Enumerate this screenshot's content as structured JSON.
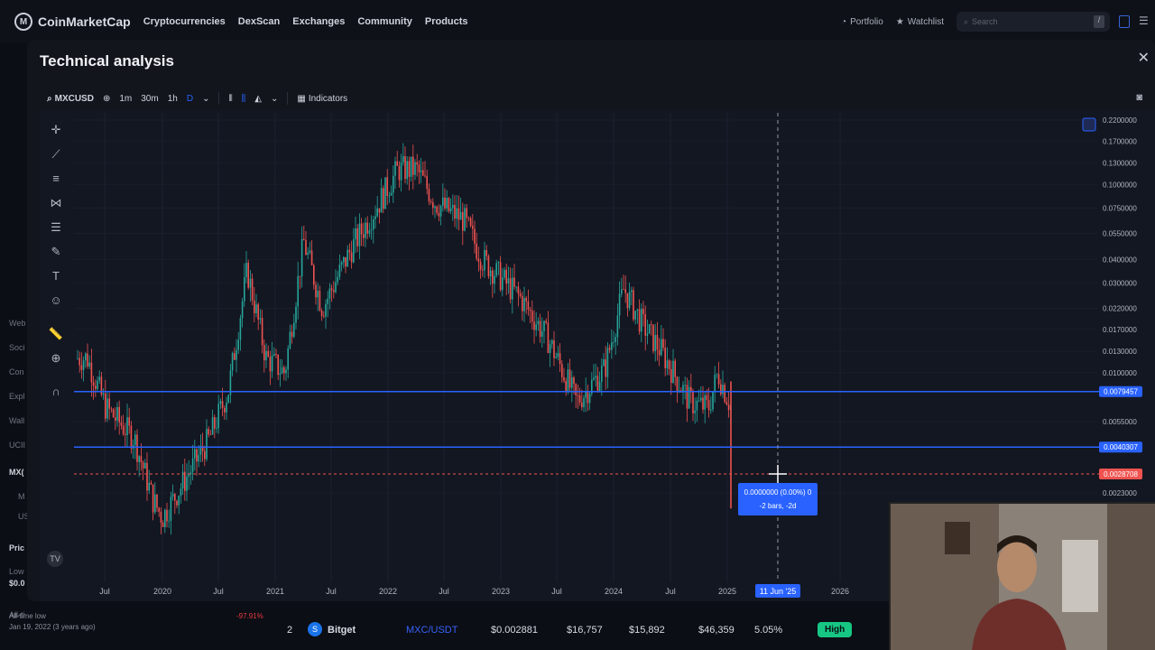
{
  "topnav": {
    "brand": "CoinMarketCap",
    "items": [
      "Cryptocurrencies",
      "DexScan",
      "Exchanges",
      "Community",
      "Products"
    ],
    "portfolio": "Portfolio",
    "watchlist": "Watchlist",
    "search_placeholder": "Search",
    "search_shortcut": "/"
  },
  "left_strip": [
    "Web",
    "Soci",
    "Con",
    "Expl",
    "Wall",
    "UCII",
    "MX(",
    "M",
    "US",
    "Pric",
    "Low",
    "$0.0",
    "All-ti"
  ],
  "modal": {
    "title": "Technical analysis",
    "close_icon": "close-icon"
  },
  "toolbar": {
    "symbol": "MXCUSD",
    "intervals": [
      "1m",
      "30m",
      "1h",
      "D"
    ],
    "active_interval": "D",
    "indicators_label": "Indicators"
  },
  "chart_data": {
    "type": "candlestick",
    "symbol": "MXCUSD",
    "x_tick_labels": [
      "Jul",
      "2020",
      "Jul",
      "2021",
      "Jul",
      "2022",
      "Jul",
      "2023",
      "Jul",
      "2024",
      "Jul",
      "2025",
      "2026"
    ],
    "crosshair_date_label": "11 Jun '25",
    "y_scale": "log",
    "y_tick_labels": [
      "0.2200000",
      "0.1700000",
      "0.1300000",
      "0.1000000",
      "0.0750000",
      "0.0550000",
      "0.0400000",
      "0.0300000",
      "0.0220000",
      "0.0170000",
      "0.0130000",
      "0.0100000",
      "0.0055000",
      "0.0023000"
    ],
    "horizontal_lines": [
      {
        "price": 0.0079457,
        "label": "0.0079457",
        "color": "#2962ff"
      },
      {
        "price": 0.0040307,
        "label": "0.0040307",
        "color": "#2962ff"
      }
    ],
    "crosshair_price_label": "0.0028708",
    "measure_tooltip": {
      "line1": "0.0000000 (0.00%) 0",
      "line2": "-2 bars, -2d"
    },
    "approx_path": [
      {
        "date": "2019-05",
        "price": 0.012
      },
      {
        "date": "2019-07",
        "price": 0.0065
      },
      {
        "date": "2019-10",
        "price": 0.0045
      },
      {
        "date": "2019-12",
        "price": 0.0021
      },
      {
        "date": "2020-01",
        "price": 0.0017
      },
      {
        "date": "2020-03",
        "price": 0.0025
      },
      {
        "date": "2020-06",
        "price": 0.0045
      },
      {
        "date": "2020-08",
        "price": 0.008
      },
      {
        "date": "2020-10",
        "price": 0.035
      },
      {
        "date": "2020-12",
        "price": 0.012
      },
      {
        "date": "2021-02",
        "price": 0.01
      },
      {
        "date": "2021-04",
        "price": 0.05
      },
      {
        "date": "2021-06",
        "price": 0.022
      },
      {
        "date": "2021-09",
        "price": 0.045
      },
      {
        "date": "2021-12",
        "price": 0.08
      },
      {
        "date": "2022-02",
        "price": 0.12
      },
      {
        "date": "2022-04",
        "price": 0.12
      },
      {
        "date": "2022-06",
        "price": 0.08
      },
      {
        "date": "2022-09",
        "price": 0.065
      },
      {
        "date": "2022-11",
        "price": 0.04
      },
      {
        "date": "2023-03",
        "price": 0.025
      },
      {
        "date": "2023-06",
        "price": 0.015
      },
      {
        "date": "2023-09",
        "price": 0.007
      },
      {
        "date": "2023-12",
        "price": 0.0105
      },
      {
        "date": "2024-02",
        "price": 0.028
      },
      {
        "date": "2024-04",
        "price": 0.018
      },
      {
        "date": "2024-06",
        "price": 0.013
      },
      {
        "date": "2024-09",
        "price": 0.007
      },
      {
        "date": "2024-11",
        "price": 0.0065
      },
      {
        "date": "2024-12",
        "price": 0.01
      },
      {
        "date": "2025-02",
        "price": 0.0055
      },
      {
        "date": "2025-03",
        "price": 0.0035
      },
      {
        "date": "2025-04",
        "price": 0.0021
      }
    ]
  },
  "market_row": {
    "rank": "2",
    "exchange": "Bitget",
    "pair": "MXC/USDT",
    "price": "$0.002881",
    "depth_plus": "$16,757",
    "depth_minus": "$15,892",
    "volume": "$46,359",
    "volume_pct": "5.05%",
    "liquidity": "High"
  },
  "bottom_left": {
    "date": "Jan 19, 2022 (3 years ago)",
    "pct": "-97.91%",
    "label": "All-time low"
  }
}
